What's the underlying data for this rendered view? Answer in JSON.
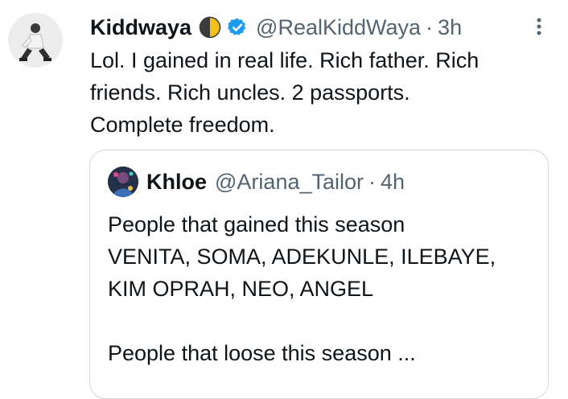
{
  "tweet": {
    "display_name": "Kiddwaya",
    "handle": "@RealKiddWaya",
    "separator": "·",
    "time": "3h",
    "text": "Lol. I gained in real life. Rich father. Rich\nfriends. Rich uncles. 2 passports.\nComplete freedom.",
    "icons": {
      "badge": "half-moon-icon",
      "verified": "verified-badge-icon",
      "more": "more-vertical-icon"
    },
    "colors": {
      "verified": "#1d9bf0",
      "secondary_text": "#536471",
      "border": "#cfd9de"
    }
  },
  "quote": {
    "display_name": "Khloe",
    "handle": "@Ariana_Tailor",
    "separator": "·",
    "time": "4h",
    "lines": [
      "People that gained this season",
      "VENITA, SOMA, ADEKUNLE, ILEBAYE,",
      "KIM OPRAH, NEO, ANGEL",
      "",
      "People that loose this season ..."
    ]
  }
}
